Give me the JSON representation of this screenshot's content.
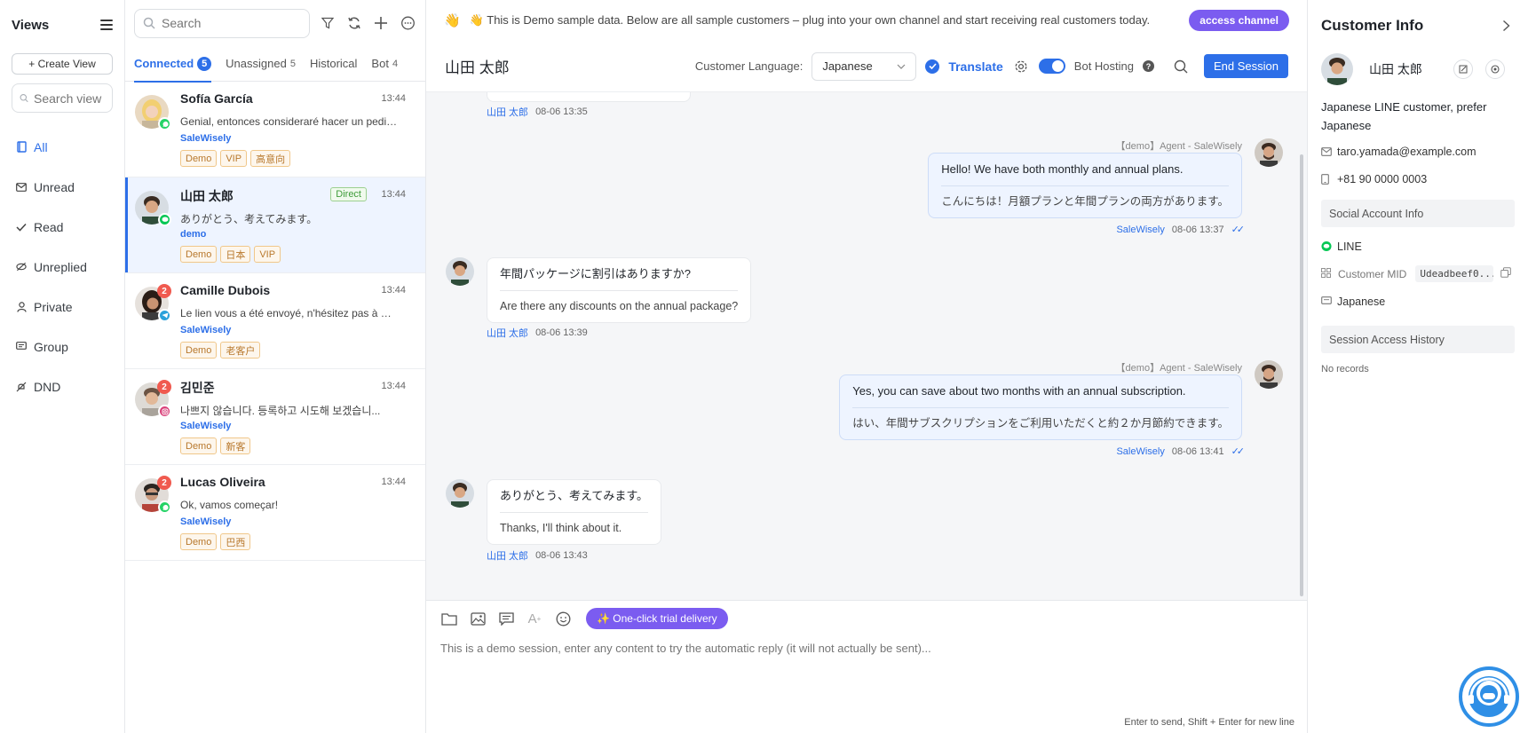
{
  "views": {
    "title": "Views",
    "create_view": "+ Create View",
    "search_placeholder": "Search view",
    "items": [
      {
        "label": "All",
        "icon": "bookmark-icon"
      },
      {
        "label": "Unread",
        "icon": "mail-icon"
      },
      {
        "label": "Read",
        "icon": "check-icon"
      },
      {
        "label": "Unreplied",
        "icon": "eye-off-icon"
      },
      {
        "label": "Private",
        "icon": "person-icon"
      },
      {
        "label": "Group",
        "icon": "chat-icon"
      },
      {
        "label": "DND",
        "icon": "bell-off-icon"
      }
    ]
  },
  "conversations": {
    "search_placeholder": "Search",
    "tabs": [
      {
        "label": "Connected",
        "count": "5"
      },
      {
        "label": "Unassigned",
        "count": "5"
      },
      {
        "label": "Historical",
        "count": ""
      },
      {
        "label": "Bot",
        "count": "4"
      }
    ],
    "items": [
      {
        "name": "Sofía García",
        "time": "13:44",
        "preview": "Genial, entonces consideraré hacer un pedido.",
        "agent": "SaleWisely",
        "tags": [
          "Demo",
          "VIP",
          "高意向"
        ],
        "channel": "whatsapp",
        "unread": ""
      },
      {
        "name": "山田 太郎",
        "time": "13:44",
        "direct": "Direct",
        "preview": "ありがとう、考えてみます。",
        "agent": "demo",
        "tags": [
          "Demo",
          "日本",
          "VIP"
        ],
        "channel": "line",
        "unread": ""
      },
      {
        "name": "Camille Dubois",
        "time": "13:44",
        "preview": "Le lien vous a été envoyé, n'hésitez pas à me...",
        "agent": "SaleWisely",
        "tags": [
          "Demo",
          "老客户"
        ],
        "channel": "telegram",
        "unread": "2"
      },
      {
        "name": "김민준",
        "time": "13:44",
        "preview": "나쁘지 않습니다. 등록하고 시도해 보겠습니...",
        "agent": "SaleWisely",
        "tags": [
          "Demo",
          "新客"
        ],
        "channel": "instagram",
        "unread": "2"
      },
      {
        "name": "Lucas Oliveira",
        "time": "13:44",
        "preview": "Ok, vamos começar!",
        "agent": "SaleWisely",
        "tags": [
          "Demo",
          "巴西"
        ],
        "channel": "whatsapp",
        "unread": "2"
      }
    ]
  },
  "banner": {
    "text": "👋 This is Demo sample data. Below are all sample customers – plug into your own channel and start receiving real customers today.",
    "button": "access channel"
  },
  "chat": {
    "title": "山田 太郎",
    "language_label": "Customer Language:",
    "language_value": "Japanese",
    "translate_label": "Translate",
    "bot_hosting_label": "Bot Hosting",
    "end_session": "End Session",
    "first_meta": {
      "who": "山田 太郎",
      "time": "08-06 13:35"
    },
    "messages": [
      {
        "dir": "out",
        "agent": "【demo】Agent - SaleWisely",
        "orig": "Hello! We have both monthly and annual plans.",
        "trans": "こんにちは！月額プランと年間プランの両方があります。",
        "who": "SaleWisely",
        "time": "08-06 13:37"
      },
      {
        "dir": "in",
        "orig": "年間パッケージに割引はありますか?",
        "trans": "Are there any discounts on the annual package?",
        "who": "山田 太郎",
        "time": "08-06 13:39"
      },
      {
        "dir": "out",
        "agent": "【demo】Agent - SaleWisely",
        "orig": "Yes, you can save about two months with an annual subscription.",
        "trans": "はい、年間サブスクリプションをご利用いただくと約２か月節約できます。",
        "who": "SaleWisely",
        "time": "08-06 13:41"
      },
      {
        "dir": "in",
        "orig": "ありがとう、考えてみます。",
        "trans": "Thanks, I'll think about it.",
        "who": "山田 太郎",
        "time": "08-06 13:43"
      }
    ]
  },
  "composer": {
    "trial_button": "✨ One-click trial delivery",
    "placeholder": "This is a demo session, enter any content to try the automatic reply (it will not actually be sent)...",
    "hint": "Enter to send, Shift + Enter for new line"
  },
  "info": {
    "title": "Customer Info",
    "name": "山田 太郎",
    "description": "Japanese LINE customer, prefer Japanese",
    "email": "taro.yamada@example.com",
    "phone": "+81 90 0000 0003",
    "social_section": "Social Account Info",
    "social_channel": "LINE",
    "mid_label": "Customer MID",
    "mid_value": "Udeadbeef0...",
    "language": "Japanese",
    "history_section": "Session Access History",
    "no_records": "No records"
  },
  "colors": {
    "accent": "#2d6fe8",
    "purple": "#7b5cf0",
    "line_green": "#06c755",
    "whatsapp_green": "#25d366",
    "telegram_blue": "#2aa1da",
    "badge_red": "#f05a4f"
  }
}
